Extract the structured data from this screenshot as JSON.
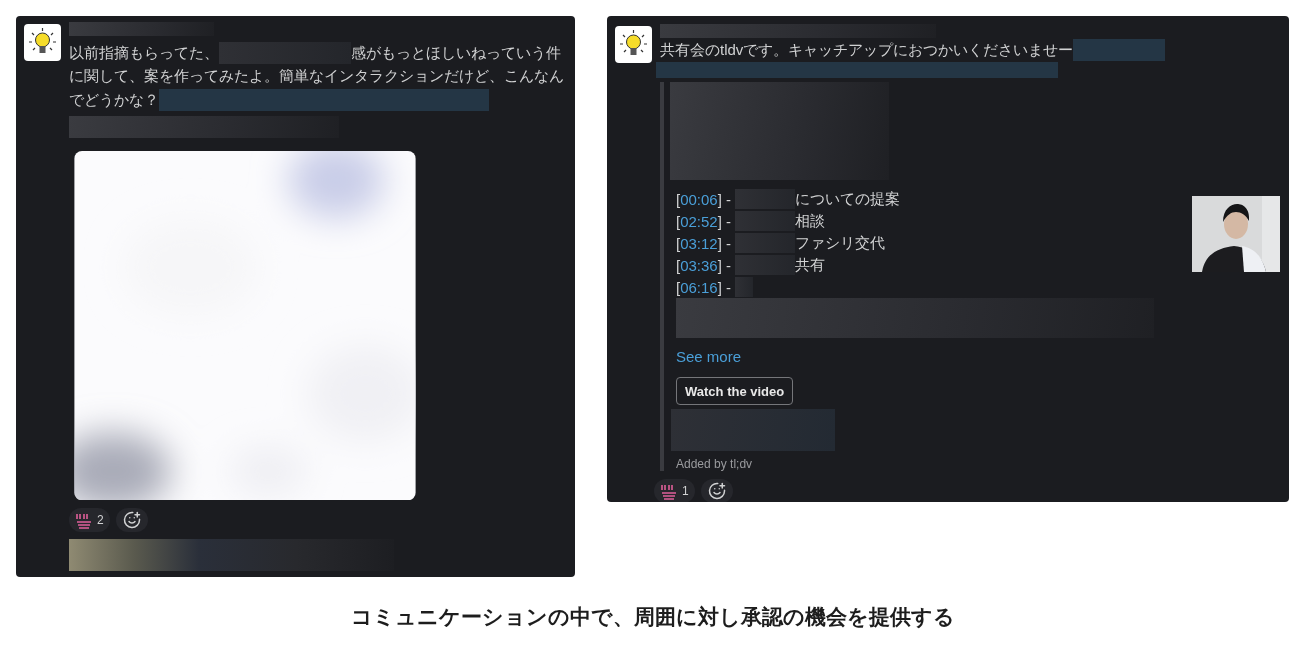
{
  "left_post": {
    "lines": [
      [
        {
          "kind": "text",
          "text": "以前指摘もらってた、"
        },
        {
          "kind": "redacted"
        },
        {
          "kind": "text",
          "text": "感がもっとほしいねっていう件"
        }
      ],
      [
        {
          "kind": "text",
          "text": "に関して、案を作ってみたよ。簡単なインタラクションだけど、こんなん"
        }
      ],
      [
        {
          "kind": "text",
          "text": "でどうかな？"
        },
        {
          "kind": "redacted"
        }
      ]
    ],
    "attachment": {
      "kind": "picture"
    },
    "reactions": [
      {
        "count": "2"
      }
    ]
  },
  "right_post": {
    "lines": [
      [
        {
          "kind": "text",
          "text": "共有会のtldvです。キャッチアップにおつかいくださいませー"
        },
        {
          "kind": "redacted"
        }
      ]
    ],
    "agenda": [
      {
        "open": "[",
        "time": "00:06",
        "close": "] -",
        "text": "についての提案"
      },
      {
        "open": "[",
        "time": "02:52",
        "close": "] -",
        "text": "相談"
      },
      {
        "open": "[",
        "time": "03:12",
        "close": "] -",
        "text": "ファシリ交代"
      },
      {
        "open": "[",
        "time": "03:36",
        "close": "] -",
        "text": "共有"
      },
      {
        "open": "[",
        "time": "06:16",
        "close": "] -"
      }
    ],
    "see_more": "See more",
    "button": "Watch the video",
    "footer": "Added by tl;dv",
    "reactions": [
      {
        "count": "1"
      }
    ]
  },
  "caption": "コミュニケーションの中で、周囲に対し承認の機会を提供する"
}
